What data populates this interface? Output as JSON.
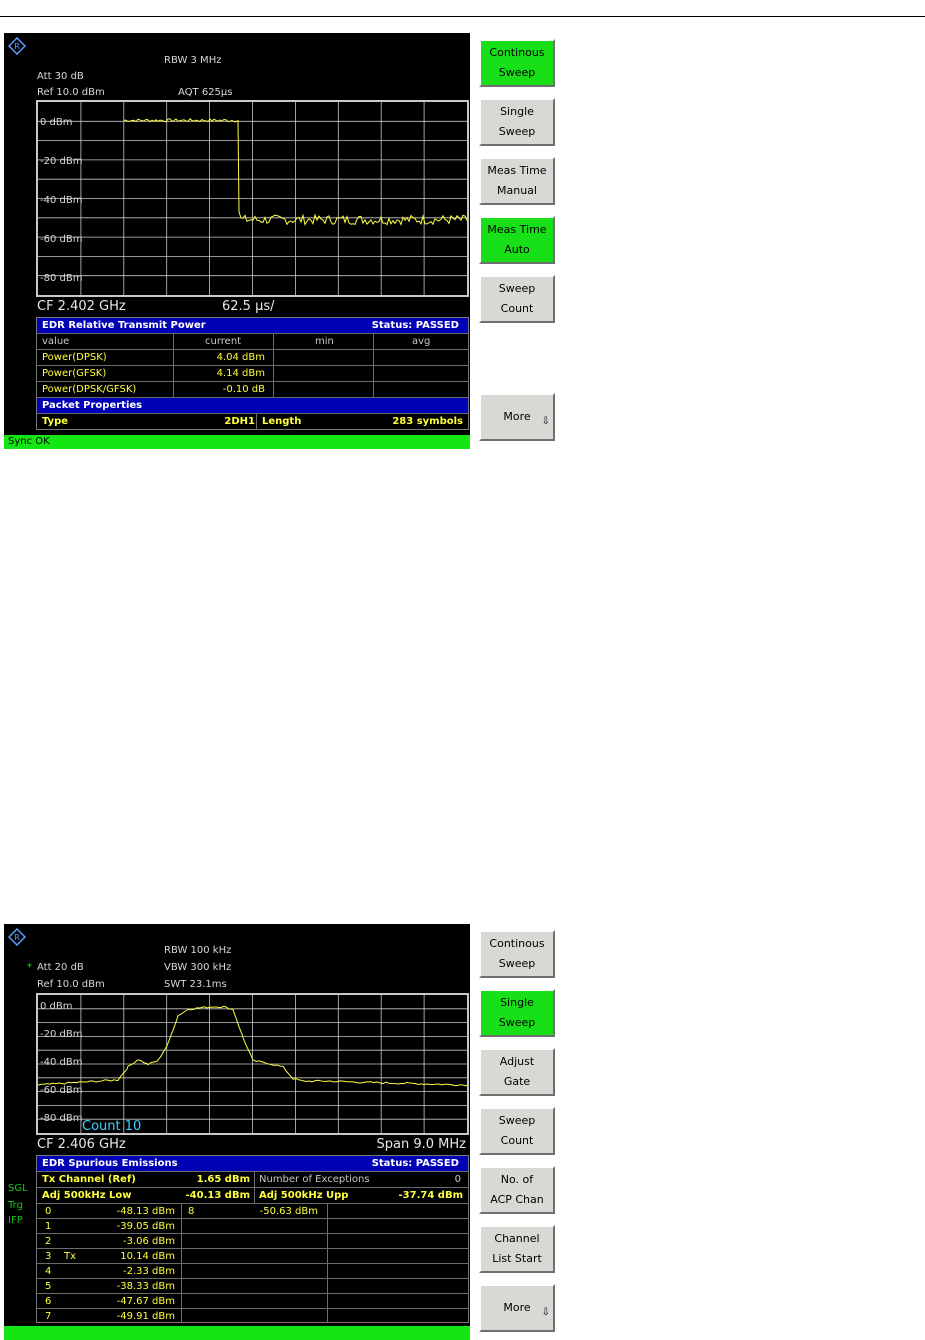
{
  "screen1": {
    "header": {
      "rbw": "RBW 3 MHz",
      "att": "Att  30 dB",
      "ref": "Ref  10.0 dBm",
      "aqt": "AQT  625µs"
    },
    "y_labels": [
      "0 dBm",
      "-20 dBm",
      "-40 dBm",
      "-60 dBm",
      "-80 dBm"
    ],
    "cf": "CF 2.402 GHz",
    "scale": "62.5 µs/",
    "result": {
      "title": "EDR Relative Transmit Power",
      "status": "Status: PASSED",
      "headers": [
        "value",
        "current",
        "min",
        "avg"
      ],
      "rows": [
        {
          "label": "Power(DPSK)",
          "current": "4.04 dBm"
        },
        {
          "label": "Power(GFSK)",
          "current": "4.14 dBm"
        },
        {
          "label": "Power(DPSK/GFSK)",
          "current": "-0.10 dB"
        }
      ],
      "packet_title": "Packet Properties",
      "packet": {
        "type_label": "Type",
        "type_value": "2DH1",
        "length_label": "Length",
        "length_value": "283 symbols"
      }
    },
    "status_bar": "Sync OK",
    "softkeys": [
      {
        "label": "Continous\nSweep",
        "active": true
      },
      {
        "label": "Single\nSweep",
        "active": false
      },
      {
        "label": "Meas Time\nManual",
        "active": false
      },
      {
        "label": "Meas Time\nAuto",
        "active": true
      },
      {
        "label": "Sweep\nCount",
        "active": false
      },
      {
        "label": "More",
        "active": false
      }
    ],
    "more_arrow": "⇩",
    "trace_colors": {
      "trace": "#ffff46",
      "grid": "#c8c8c8"
    }
  },
  "screen2": {
    "header": {
      "rbw": "RBW 100 kHz",
      "vbw": "VBW 300 kHz",
      "swt": "SWT 23.1ms",
      "att": "Att  20 dB",
      "ref": "Ref  10.0 dBm",
      "att_marker": "*"
    },
    "y_labels": [
      "0 dBm",
      "-20 dBm",
      "-40 dBm",
      "-60 dBm",
      "-80 dBm"
    ],
    "count": "Count 10",
    "cf": "CF 2.406 GHz",
    "span": "Span 9.0 MHz",
    "side_labels": [
      "SGL",
      "Trg",
      "IFP"
    ],
    "result": {
      "title": "EDR Spurious Emissions",
      "status": "Status: PASSED",
      "tx_label": "Tx Channel (Ref)",
      "tx_value": "1.65 dBm",
      "exceptions_label": "Number of Exceptions",
      "exceptions_value": "0",
      "adj_low_label": "Adj 500kHz Low",
      "adj_low_value": "-40.13 dBm",
      "adj_upp_label": "Adj 500kHz Upp",
      "adj_upp_value": "-37.74 dBm",
      "channels": [
        {
          "num": "0",
          "tag": "",
          "value": "-48.13 dBm"
        },
        {
          "num": "1",
          "tag": "",
          "value": "-39.05 dBm"
        },
        {
          "num": "2",
          "tag": "",
          "value": "-3.06 dBm"
        },
        {
          "num": "3",
          "tag": "Tx",
          "value": "10.14 dBm"
        },
        {
          "num": "4",
          "tag": "",
          "value": "-2.33 dBm"
        },
        {
          "num": "5",
          "tag": "",
          "value": "-38.33 dBm"
        },
        {
          "num": "6",
          "tag": "",
          "value": "-47.67 dBm"
        },
        {
          "num": "7",
          "tag": "",
          "value": "-49.91 dBm"
        }
      ],
      "channel8": {
        "num": "8",
        "value": "-50.63 dBm"
      }
    },
    "softkeys": [
      {
        "label": "Continous\nSweep",
        "active": false
      },
      {
        "label": "Single\nSweep",
        "active": true
      },
      {
        "label": "Adjust\nGate",
        "active": false
      },
      {
        "label": "Sweep\nCount",
        "active": false
      },
      {
        "label": "No. of\nACP Chan",
        "active": false
      },
      {
        "label": "Channel\nList Start",
        "active": false
      },
      {
        "label": "More",
        "active": false
      }
    ],
    "more_arrow": "⇩"
  }
}
